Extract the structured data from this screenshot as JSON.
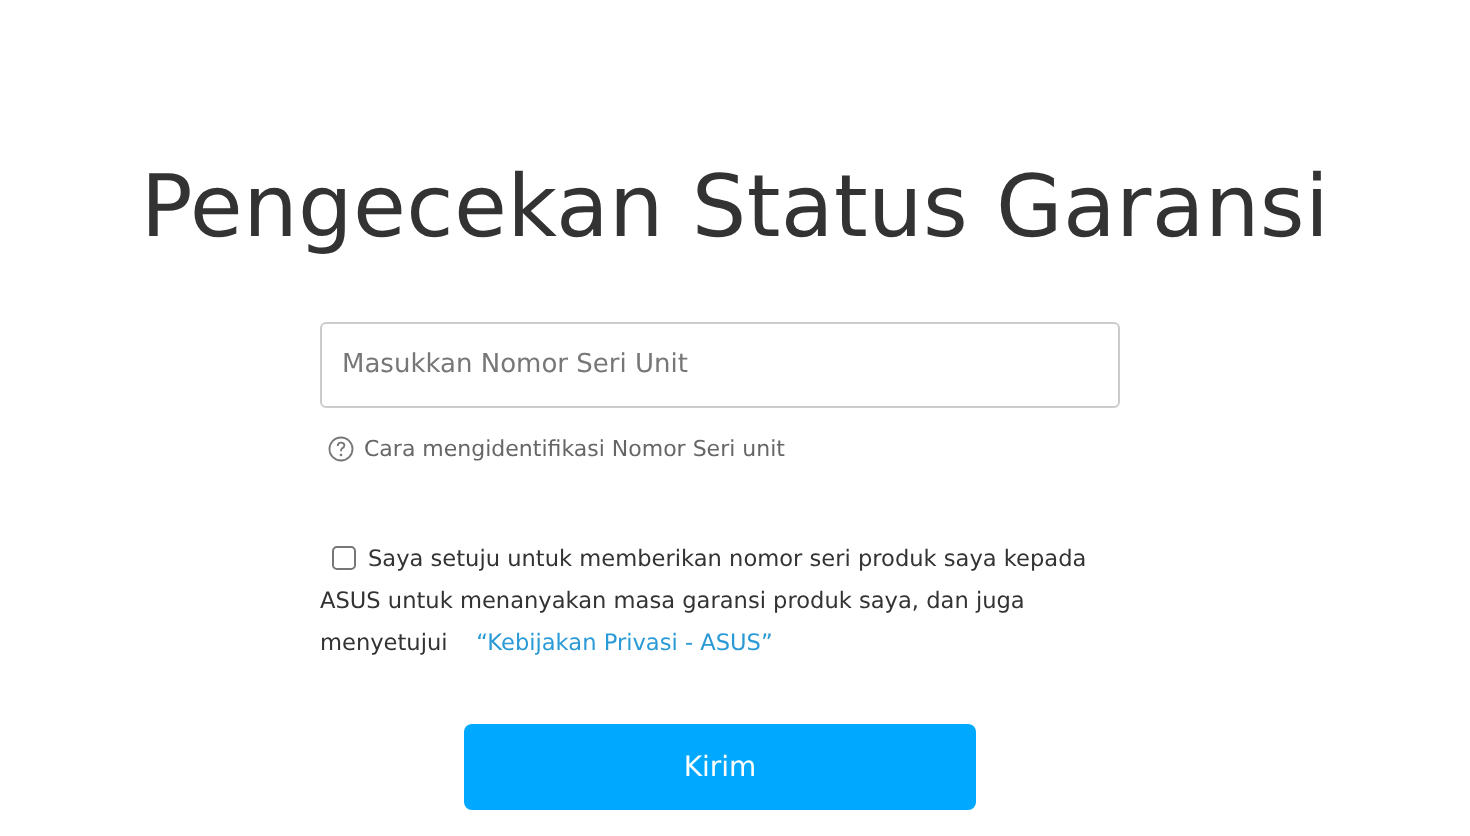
{
  "title": "Pengecekan Status Garansi",
  "serial_field": {
    "placeholder": "Masukkan Nomor Seri Unit"
  },
  "help_link": "Cara mengidentifikasi Nomor Seri unit",
  "consent": {
    "checked": false,
    "text": "Saya setuju untuk memberikan nomor seri produk saya kepada ASUS untuk menanyakan masa garansi produk saya, dan juga menyetujui",
    "link": "“Kebijakan Privasi - ASUS”"
  },
  "submit_button": "Kirim"
}
